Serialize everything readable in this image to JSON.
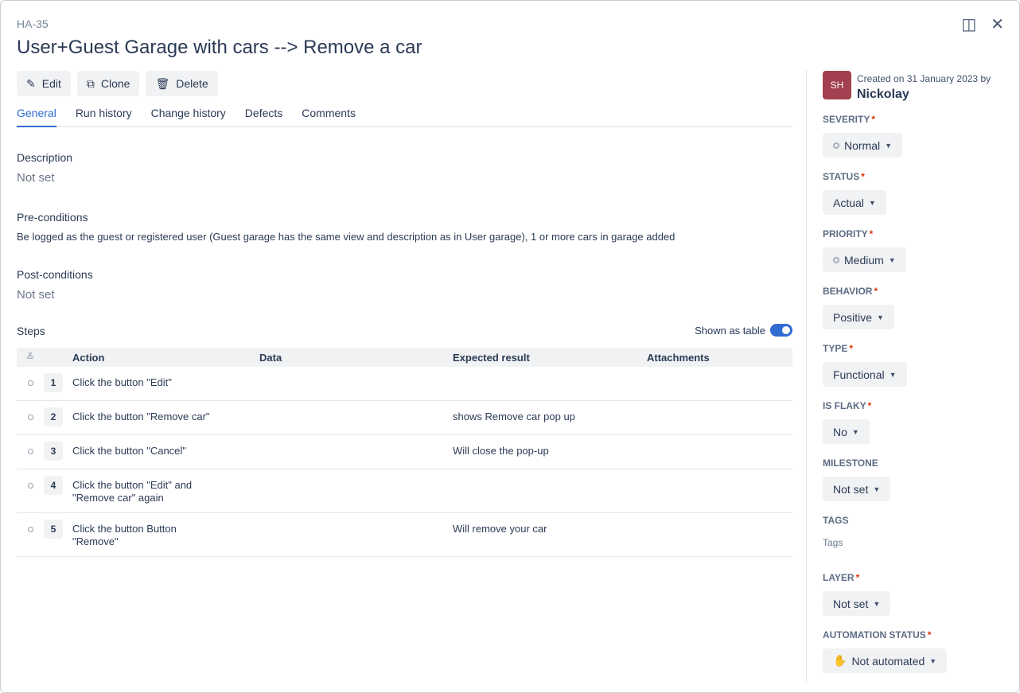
{
  "header": {
    "key": "HA-35",
    "title": "User+Guest Garage with cars --> Remove a car"
  },
  "actions": {
    "edit": "Edit",
    "clone": "Clone",
    "delete": "Delete"
  },
  "tabs": [
    "General",
    "Run history",
    "Change history",
    "Defects",
    "Comments"
  ],
  "description": {
    "label": "Description",
    "value": "Not set"
  },
  "preconditions": {
    "label": "Pre-conditions",
    "value": "Be logged as the guest or registered user (Guest garage has the same view and description as in User garage), 1 or more cars in garage added"
  },
  "postconditions": {
    "label": "Post-conditions",
    "value": "Not set"
  },
  "steps": {
    "label": "Steps",
    "toggle_label": "Shown as table",
    "toggle_on": true,
    "columns": [
      "Action",
      "Data",
      "Expected result",
      "Attachments"
    ],
    "rows": [
      {
        "n": "1",
        "action": "Click the button \"Edit\"",
        "data": "",
        "expected": ""
      },
      {
        "n": "2",
        "action": "Click the button \"Remove car\"",
        "data": "",
        "expected": "shows Remove car pop up"
      },
      {
        "n": "3",
        "action": "Click the button \"Cancel\"",
        "data": "",
        "expected": "Will close the pop-up"
      },
      {
        "n": "4",
        "action": "Click the button \"Edit\" and \"Remove car\" again",
        "data": "",
        "expected": ""
      },
      {
        "n": "5",
        "action": "Click the button Button \"Remove\"",
        "data": "",
        "expected": "Will remove your car"
      }
    ]
  },
  "sidebar": {
    "avatar": "SH",
    "created": "Created on 31 January 2023 by",
    "creator": "Nickolay",
    "fields": [
      {
        "label": "SEVERITY",
        "value": "Normal",
        "req": true,
        "dot": true
      },
      {
        "label": "STATUS",
        "value": "Actual",
        "req": true
      },
      {
        "label": "PRIORITY",
        "value": "Medium",
        "req": true,
        "dot": true
      },
      {
        "label": "BEHAVIOR",
        "value": "Positive",
        "req": true
      },
      {
        "label": "TYPE",
        "value": "Functional",
        "req": true
      },
      {
        "label": "IS FLAKY",
        "value": "No",
        "req": true
      },
      {
        "label": "MILESTONE",
        "value": "Not set",
        "req": false
      },
      {
        "label": "TAGS",
        "value": "Tags",
        "req": false,
        "plain": true
      },
      {
        "label": "LAYER",
        "value": "Not set",
        "req": true
      },
      {
        "label": "AUTOMATION STATUS",
        "value": "Not automated",
        "req": true,
        "hand": true
      }
    ]
  }
}
